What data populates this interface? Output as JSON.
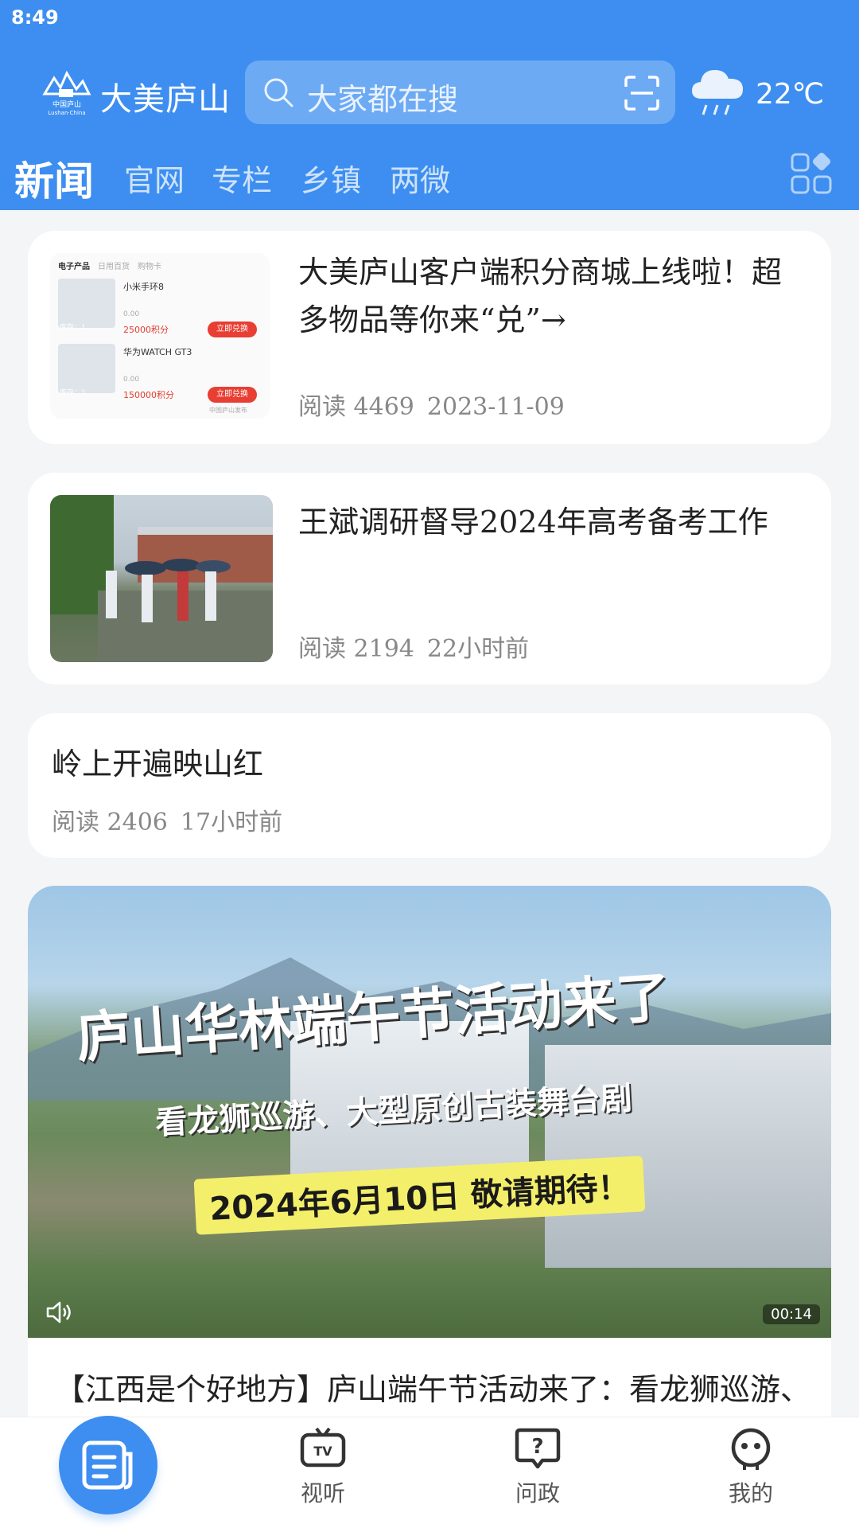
{
  "status_bar": {
    "time": "8:49"
  },
  "header": {
    "brand": "大美庐山",
    "logo_text": "中国庐山 Lushan·China",
    "search_placeholder": "大家都在搜",
    "temperature": "22℃",
    "weather_icon": "rain-cloud-icon"
  },
  "tabs": [
    {
      "label": "新闻",
      "active": true
    },
    {
      "label": "官网"
    },
    {
      "label": "专栏"
    },
    {
      "label": "乡镇"
    },
    {
      "label": "两微"
    }
  ],
  "articles": [
    {
      "title": "大美庐山客户端积分商城上线啦！超多物品等你来“兑”→",
      "reads": "阅读 4469",
      "date": "2023-11-09",
      "thumb": {
        "tabs": [
          "电子产品",
          "日用百货",
          "购物卡"
        ],
        "items": [
          {
            "name": "小米手环8",
            "points": "25000积分",
            "stock": "库存：1",
            "old": "0.00",
            "button": "立即兑换"
          },
          {
            "name": "华为WATCH GT3",
            "points": "150000积分",
            "stock": "库存：1",
            "old": "0.00",
            "button": "立即兑换"
          }
        ],
        "watermark": "中国庐山发布"
      }
    },
    {
      "title": "王斌调研督导2024年高考备考工作",
      "reads": "阅读 2194",
      "date": "22小时前"
    },
    {
      "title": "岭上开遍映山红",
      "reads": "阅读 2406",
      "date": "17小时前"
    }
  ],
  "video": {
    "headline": "庐山华林端午节活动来了",
    "subline": "看龙狮巡游、大型原创古装舞台剧",
    "banner": "2024年6月10日 敬请期待！",
    "duration": "00:14",
    "caption": "【江西是个好地方】庐山端午节活动来了：看龙狮巡游、"
  },
  "bottom_nav": [
    {
      "label": "",
      "icon": "news-icon",
      "active": true
    },
    {
      "label": "视听",
      "icon": "tv-icon"
    },
    {
      "label": "问政",
      "icon": "question-icon"
    },
    {
      "label": "我的",
      "icon": "robot-icon"
    }
  ],
  "colors": {
    "primary": "#3d8ef0",
    "button_red": "#e83e33"
  }
}
